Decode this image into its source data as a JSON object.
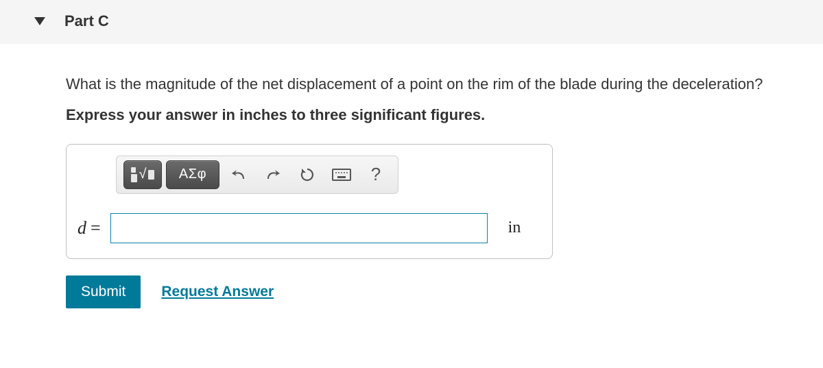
{
  "header": {
    "part_label": "Part C"
  },
  "question": {
    "prompt": "What is the magnitude of the net displacement of a point on the rim of the blade during the deceleration?",
    "instruction": "Express your answer in inches to three significant figures."
  },
  "toolbar": {
    "template_button_title": "Templates",
    "greek_button_label": "ΑΣφ",
    "greek_button_title": "Greek/special characters",
    "undo_title": "Undo",
    "redo_title": "Redo",
    "reset_title": "Reset",
    "keyboard_title": "Keyboard shortcuts",
    "help_label": "?",
    "help_title": "Help"
  },
  "answer": {
    "variable": "d",
    "equals": "=",
    "value": "",
    "unit": "in"
  },
  "actions": {
    "submit_label": "Submit",
    "request_label": "Request Answer"
  }
}
